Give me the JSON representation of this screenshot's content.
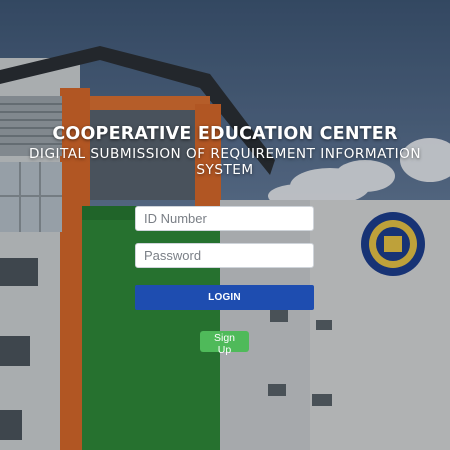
{
  "header": {
    "title": "COOPERATIVE EDUCATION CENTER",
    "subtitle": "DIGITAL SUBMISSION OF REQUIREMENT INFORMATION SYSTEM"
  },
  "login_form": {
    "id_placeholder": "ID Number",
    "password_placeholder": "Password",
    "login_label": "LOGIN",
    "signup_label": "Sign Up"
  },
  "colors": {
    "login_button": "#1e4db0",
    "signup_button": "#4fba5a"
  },
  "icons": {
    "background": "campus-building-photo",
    "seal": "university-seal-icon"
  }
}
